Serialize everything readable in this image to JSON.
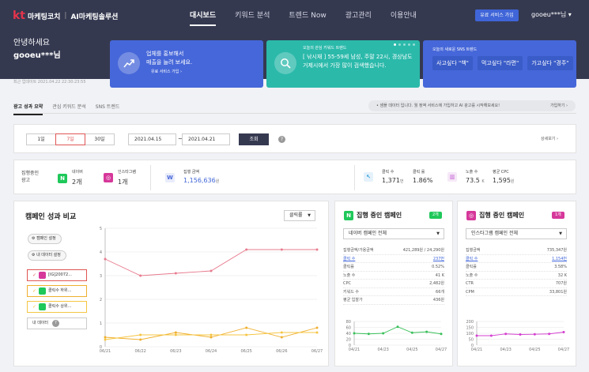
{
  "brand": {
    "mark": "kt",
    "name": "마케팅코치",
    "sep": "|",
    "sub": "AI마케팅솔루션"
  },
  "nav": [
    "대시보드",
    "키워드 분석",
    "트렌드 Now",
    "광고관리",
    "이용안내"
  ],
  "header": {
    "paid_button": "유료 서비스 가입",
    "user": "gooeu***님"
  },
  "greeting": {
    "line1": "안녕하세요",
    "user": "gooeu***님"
  },
  "updated": "최근 업데이트 2021.04.22 22:30:23:55",
  "card1": {
    "line1": "업체를 홍보해서",
    "line2": "매출을 늘려 보세요.",
    "link": "유료 서비스 가입 ›"
  },
  "card2": {
    "small": "오늘의 관심 키워드 트렌드",
    "text": "[ 낚시재 ] 55-59세 남성, 주말 22시, 경상남도 거제시에서 가장 많이 검색했습니다."
  },
  "card3": {
    "small": "오늘의 새로운 SNS 트렌드",
    "chips": [
      "사고싶다 \"책\"",
      "먹고싶다 \"라면\"",
      "가고싶다 \"경주\""
    ]
  },
  "tabs": [
    "광고 성과 요약",
    "관심 키워드 분석",
    "SNS 트렌드"
  ],
  "notice": {
    "text": "• 샘플 데이터 입니다. 월 정액 서비스에 가입하고 AI 광고를 시작해보세요!",
    "action": "가입하기 ›"
  },
  "filter": {
    "periods": [
      "1일",
      "7일",
      "30일"
    ],
    "from": "2021.04.15",
    "to": "2021.04.21",
    "tilde": "~",
    "search": "조회",
    "help": "?",
    "detail": "상세보기 ›"
  },
  "stats": {
    "running_label1": "집행중인",
    "running_label2": "광고",
    "naver": {
      "label": "네이버",
      "value": "2개"
    },
    "insta": {
      "label": "인스타그램",
      "value": "1개"
    },
    "amount": {
      "label": "집행 금액",
      "value": "1,156,636",
      "unit": "원"
    },
    "clicks": {
      "label": "클릭 수",
      "value": "1,371",
      "unit": "번"
    },
    "ctr": {
      "label": "클릭 률",
      "value": "1.86%"
    },
    "impressions": {
      "label": "노출 수",
      "value": "73.5",
      "unit": "K"
    },
    "cpc": {
      "label": "평균 CPC",
      "value": "1,595",
      "unit": "원"
    }
  },
  "compare": {
    "title": "캠페인 성과 비교",
    "metric": "클릭률",
    "campaign_setting": "캠페인 설정",
    "data_setting": "내 데이터 설정",
    "legend": [
      "[IG]20072...",
      "클릭수 하위...",
      "클릭수 상위..."
    ],
    "my_data": "내 데이터"
  },
  "naver_panel": {
    "title": "집행 중인 캠페인",
    "badge": "2개",
    "select": "네이버 캠페인 전체",
    "rows": [
      [
        "집행금액/가용금액",
        "421,289원 / 24,290원"
      ],
      [
        "클릭 수",
        "237번"
      ],
      [
        "클릭률",
        "0.52%"
      ],
      [
        "노출 수",
        "41 K"
      ],
      [
        "CPC",
        "2,482원"
      ],
      [
        "키워드 수",
        "66개"
      ],
      [
        "평균 입찰가",
        "436원"
      ]
    ],
    "x": [
      "04/21",
      "04/23",
      "04/25",
      "04/27"
    ],
    "yticks": [
      "80",
      "60",
      "40",
      "20",
      "0"
    ]
  },
  "insta_panel": {
    "title": "집행 중인 캠페인",
    "badge": "1개",
    "select": "인스타그램 캠페인 전체",
    "rows": [
      [
        "집행금액",
        "735,347원"
      ],
      [
        "클릭 수",
        "1,154번"
      ],
      [
        "클릭률",
        "3.58%"
      ],
      [
        "노출 수",
        "32 K"
      ],
      [
        "CTR",
        "707원"
      ],
      [
        "CPM",
        "33,801원"
      ]
    ],
    "x": [
      "04/21",
      "04/23",
      "04/25",
      "04/27"
    ],
    "yticks": [
      "200",
      "150",
      "100",
      "50",
      "0"
    ]
  },
  "chart_data": [
    {
      "type": "line",
      "x": [
        "06/21",
        "06/22",
        "06/23",
        "06/24",
        "06/25",
        "06/26",
        "06/27"
      ],
      "ylim": [
        0,
        5
      ],
      "yticks": [
        "5",
        "4",
        "3",
        "2",
        "1",
        "0"
      ],
      "series": [
        {
          "name": "[IG]20072...",
          "color": "#e87b8e",
          "values": [
            3.7,
            3.0,
            3.1,
            3.2,
            4.1,
            4.1,
            4.1
          ]
        },
        {
          "name": "클릭수 하위...",
          "color": "#f0b030",
          "values": [
            0.4,
            0.3,
            0.6,
            0.4,
            0.8,
            0.4,
            0.8
          ]
        },
        {
          "name": "클릭수 상위...",
          "color": "#f5c542",
          "values": [
            0.3,
            0.5,
            0.5,
            0.5,
            0.5,
            0.6,
            0.6
          ]
        }
      ]
    },
    {
      "type": "line",
      "x": [
        "04/21",
        "04/22",
        "04/23",
        "04/24",
        "04/25",
        "04/26",
        "04/27"
      ],
      "ylim": [
        0,
        80
      ],
      "series": [
        {
          "color": "#39c05a",
          "values": [
            40,
            38,
            40,
            62,
            42,
            45,
            38
          ]
        }
      ]
    },
    {
      "type": "line",
      "x": [
        "04/21",
        "04/22",
        "04/23",
        "04/24",
        "04/25",
        "04/26",
        "04/27"
      ],
      "ylim": [
        0,
        200
      ],
      "series": [
        {
          "color": "#d43fd0",
          "values": [
            80,
            80,
            95,
            90,
            92,
            95,
            110
          ]
        }
      ]
    }
  ],
  "colors": {
    "header": "#353950",
    "accent": "#3f65d8",
    "teal": "#2bb9aa",
    "naver": "#1fc85a",
    "insta": "#d6389a",
    "red": "#e05555"
  }
}
